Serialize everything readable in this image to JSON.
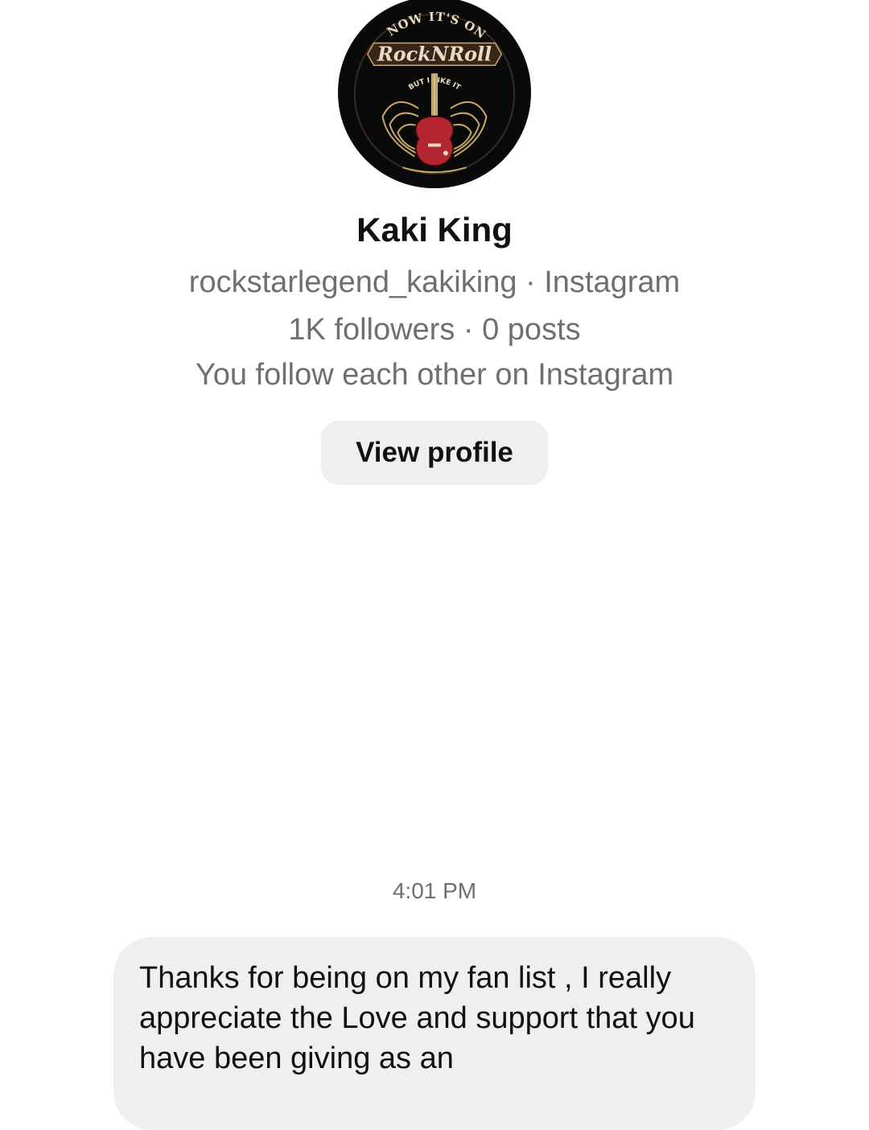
{
  "profile": {
    "avatar_icon": "rock-n-roll-guitar-logo",
    "avatar_text_top": "I KNOW IT'S ONLY",
    "avatar_text_main": "RockNRoll",
    "avatar_text_arc": "BUT I LIKE IT",
    "name": "Kaki King",
    "handle_line": "rockstarlegend_kakiking · Instagram",
    "stats_line": "1K followers · 0 posts",
    "relationship_line": "You follow each other on Instagram",
    "view_profile_label": "View profile"
  },
  "conversation": {
    "timestamp": "4:01 PM",
    "messages": [
      {
        "text": "Thanks for being on my fan list , I really appreciate the Love and support that you have been giving as an"
      }
    ]
  },
  "colors": {
    "background": "#ffffff",
    "secondary_text": "#6f6f6f",
    "bubble": "#efefef",
    "button": "#efefef",
    "logo_red": "#b3262f",
    "logo_gold": "#c9a86a"
  }
}
